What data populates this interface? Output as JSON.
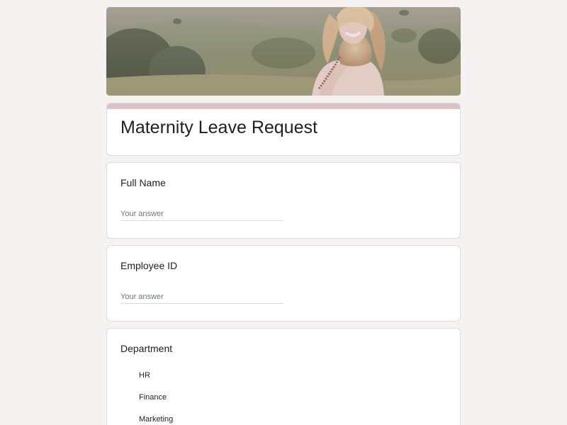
{
  "form": {
    "title": "Maternity Leave Request"
  },
  "questions": {
    "full_name": {
      "label": "Full Name",
      "placeholder": "Your answer"
    },
    "employee_id": {
      "label": "Employee ID",
      "placeholder": "Your answer"
    },
    "department": {
      "label": "Department",
      "options": [
        "HR",
        "Finance",
        "Marketing"
      ]
    }
  },
  "colors": {
    "page_background": "#f6f2f2",
    "title_accent": "#d9c3c7",
    "card_border": "#dadce0"
  },
  "banner": {
    "image": "header-photo"
  }
}
